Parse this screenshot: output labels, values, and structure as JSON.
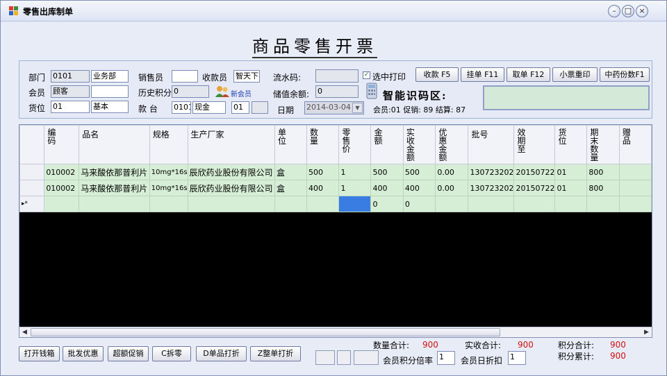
{
  "window": {
    "title": "零售出库制单",
    "minimize": "–",
    "maximize": "□",
    "close": "×"
  },
  "heading": "商品零售开票",
  "form": {
    "dept_label": "部门",
    "dept_code": "0101",
    "dept_name": "业务部",
    "member_label": "会员",
    "member_code": "顾客",
    "member_name": "",
    "location_label": "货位",
    "location_code": "01",
    "location_name": "基本",
    "salesman_label": "销售员",
    "salesman": "",
    "cashier_label": "收款员",
    "cashier": "智天下",
    "points_label": "历史积分",
    "points": "0",
    "new_member_label": "新会员",
    "counter_label": "款  台",
    "counter_code": "0101",
    "counter_name": "现金",
    "counter_no": "01",
    "counter_extra": "",
    "serial_label": "流水码:",
    "serial": "",
    "balance_label": "储值余额:",
    "balance": "0",
    "date_label": "日期",
    "date": "2014-03-04",
    "print_label": "选中打印",
    "print_checked": "✓",
    "smart_label": "智能识码区:",
    "summary": "会员:01 促销: 89 结算: 87"
  },
  "toolbar": {
    "collect": "收款 F5",
    "hold": "挂单 F11",
    "retrieve": "取单 F12",
    "reprint": "小票重印",
    "herb": "中药份数F1"
  },
  "grid": {
    "columns": [
      "编码",
      "品名",
      "规格",
      "生产厂家",
      "单位",
      "数量",
      "零售价",
      "金额",
      "实收金额",
      "优惠金额",
      "批号",
      "效期至",
      "货位",
      "期末数量",
      "赠品"
    ],
    "rows": [
      [
        "010002",
        "马来酸依那普利片",
        "10mg*16s",
        "辰欣药业股份有限公司",
        "盒",
        "500",
        "1",
        "500",
        "500",
        "0.00",
        "130723202",
        "20150722",
        "01",
        "800",
        ""
      ],
      [
        "010002",
        "马来酸依那普利片",
        "10mg*16s",
        "辰欣药业股份有限公司",
        "盒",
        "400",
        "1",
        "400",
        "400",
        "0.00",
        "130723202",
        "20150722",
        "01",
        "800",
        ""
      ]
    ],
    "new_row_marker": "▸*",
    "new_row": {
      "amount": "0",
      "received": "0"
    }
  },
  "bottom": {
    "open_drawer": "打开钱箱",
    "wholesale": "批发优惠",
    "promo": "超额促销",
    "split": "C拆零",
    "print_item": "D单品打折",
    "print_order": "Z整单打折",
    "qty_total_label": "数量合计:",
    "qty_total": "900",
    "received_total_label": "实收合计:",
    "received_total": "900",
    "points_total_label": "积分合计:",
    "points_total": "900",
    "points_accum_label": "积分累计:",
    "points_accum": "900",
    "rate_label": "会员积分倍率",
    "rate": "1",
    "discount_label": "会员日折扣",
    "discount": "1"
  }
}
